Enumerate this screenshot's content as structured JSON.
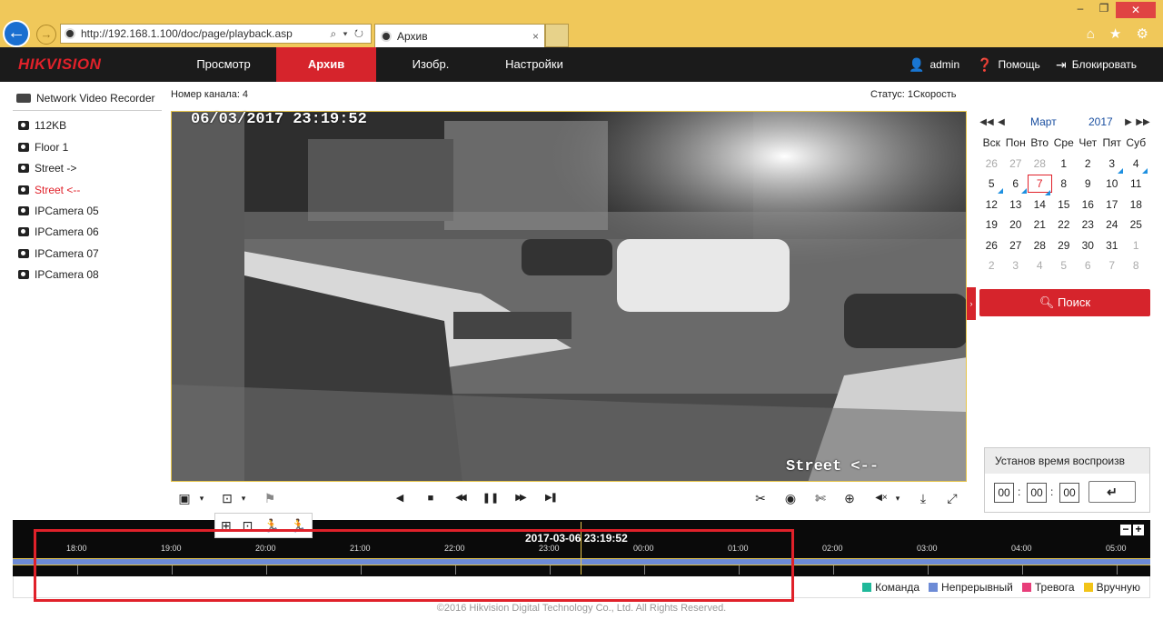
{
  "browser": {
    "url": "http://192.168.1.100/doc/page/playback.asp",
    "url_controls": "⌕ ▾ ↻",
    "tab_title": "Архив",
    "tab_close": "×",
    "window_controls": [
      "–",
      "❐",
      "✕"
    ],
    "toolbar_icons": "⌂ ★ ⚙"
  },
  "nav": {
    "logo": "HIKVISION",
    "items": [
      {
        "label": "Просмотр",
        "active": false
      },
      {
        "label": "Архив",
        "active": true
      },
      {
        "label": "Изобр.",
        "active": false
      },
      {
        "label": "Настройки",
        "active": false
      }
    ],
    "user": "admin",
    "help": "Помощь",
    "lock": "Блокировать"
  },
  "left": {
    "device": "Network Video Recorder",
    "cameras": [
      {
        "label": "112KB",
        "selected": false
      },
      {
        "label": "Floor 1",
        "selected": false
      },
      {
        "label": "Street ->",
        "selected": false
      },
      {
        "label": "Street <--",
        "selected": true
      },
      {
        "label": "IPCamera 05",
        "selected": false
      },
      {
        "label": "IPCamera 06",
        "selected": false
      },
      {
        "label": "IPCamera 07",
        "selected": false
      },
      {
        "label": "IPCamera 08",
        "selected": false
      }
    ]
  },
  "video": {
    "channel": "Номер канала: 4",
    "status": "Статус: 1Скорость",
    "osd_timestamp": "06/03/2017 23:19:52",
    "osd_name": "Street <--"
  },
  "toolbar": {
    "left": [
      "▣",
      "▾",
      "⊡",
      "▾",
      "⚑"
    ],
    "center": [
      "◀",
      "■",
      "◀◀",
      "❚❚",
      "▶▶",
      "▶❚"
    ],
    "right": [
      "✂",
      "◉",
      "✄",
      "⊕",
      "◀×",
      "▾",
      "⤓",
      "⤢"
    ],
    "extra": [
      "⊞",
      "⊡",
      "🏃",
      "🏃"
    ]
  },
  "calendar": {
    "month": "Март",
    "year": "2017",
    "weekdays": [
      "Вск",
      "Пон",
      "Вто",
      "Сре",
      "Чет",
      "Пят",
      "Суб"
    ],
    "weeks": [
      [
        {
          "d": "26",
          "g": true
        },
        {
          "d": "27",
          "g": true
        },
        {
          "d": "28",
          "g": true
        },
        {
          "d": "1"
        },
        {
          "d": "2"
        },
        {
          "d": "3",
          "m": true
        },
        {
          "d": "4",
          "m": true
        }
      ],
      [
        {
          "d": "5",
          "m": true
        },
        {
          "d": "6",
          "m": true
        },
        {
          "d": "7",
          "today": true,
          "m": true
        },
        {
          "d": "8"
        },
        {
          "d": "9"
        },
        {
          "d": "10"
        },
        {
          "d": "11"
        }
      ],
      [
        {
          "d": "12"
        },
        {
          "d": "13"
        },
        {
          "d": "14"
        },
        {
          "d": "15"
        },
        {
          "d": "16"
        },
        {
          "d": "17"
        },
        {
          "d": "18"
        }
      ],
      [
        {
          "d": "19"
        },
        {
          "d": "20"
        },
        {
          "d": "21"
        },
        {
          "d": "22"
        },
        {
          "d": "23"
        },
        {
          "d": "24"
        },
        {
          "d": "25"
        }
      ],
      [
        {
          "d": "26"
        },
        {
          "d": "27"
        },
        {
          "d": "28"
        },
        {
          "d": "29"
        },
        {
          "d": "30"
        },
        {
          "d": "31"
        },
        {
          "d": "1",
          "g": true
        }
      ],
      [
        {
          "d": "2",
          "g": true
        },
        {
          "d": "3",
          "g": true
        },
        {
          "d": "4",
          "g": true
        },
        {
          "d": "5",
          "g": true
        },
        {
          "d": "6",
          "g": true
        },
        {
          "d": "7",
          "g": true
        },
        {
          "d": "8",
          "g": true
        }
      ]
    ],
    "search_label": "Поиск"
  },
  "timeset": {
    "header": "Установ время воспроизв",
    "hh": "00",
    "mm": "00",
    "ss": "00",
    "go": "↵"
  },
  "timeline": {
    "current": "2017-03-06 23:19:52",
    "hours": [
      "18:00",
      "19:00",
      "20:00",
      "21:00",
      "22:00",
      "23:00",
      "00:00",
      "01:00",
      "02:00",
      "03:00",
      "04:00",
      "05:00"
    ],
    "zoom_out": "−",
    "zoom_in": "+"
  },
  "legend": [
    {
      "label": "Команда",
      "color": "#1fb89a"
    },
    {
      "label": "Непрерывный",
      "color": "#6d8bd6"
    },
    {
      "label": "Тревога",
      "color": "#e83e7a"
    },
    {
      "label": "Вручную",
      "color": "#f2c418"
    }
  ],
  "footer": "©2016 Hikvision Digital Technology Co., Ltd. All Rights Reserved.",
  "colors": {
    "brand_red": "#d6242c",
    "accent_gold": "#e5c44a",
    "chrome": "#f0c85a"
  }
}
